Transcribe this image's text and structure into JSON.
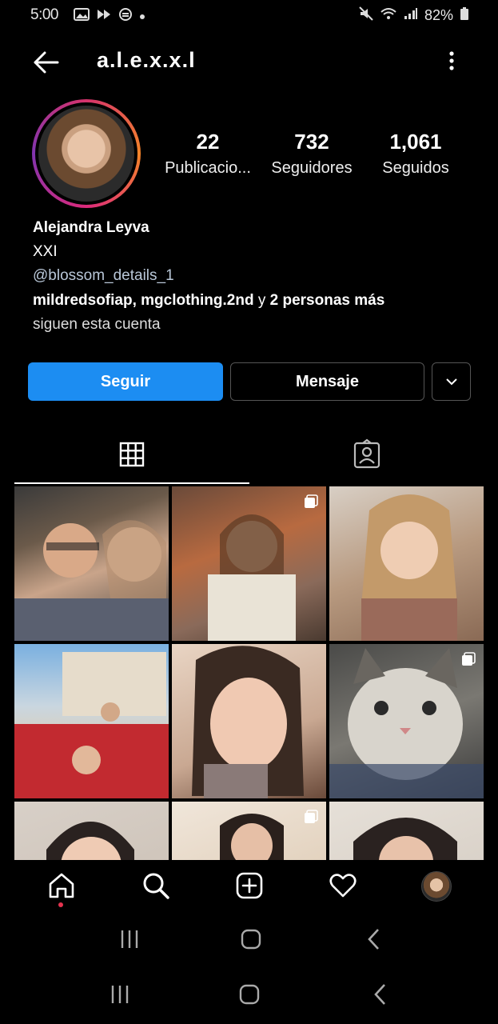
{
  "status_bar": {
    "time": "5:00",
    "battery": "82%"
  },
  "header": {
    "username": "a.l.e.x.x.l"
  },
  "stats": [
    {
      "value": "22",
      "label": "Publicacio..."
    },
    {
      "value": "732",
      "label": "Seguidores"
    },
    {
      "value": "1,061",
      "label": "Seguidos"
    }
  ],
  "bio": {
    "name": "Alejandra Leyva",
    "category": "XXI",
    "link": "@blossom_details_1",
    "followed_by_bold": "mildredsofiap, mgclothing.2nd",
    "followed_by_and": " y ",
    "followed_by_more": "2 personas más",
    "followed_by_line2": "siguen esta cuenta"
  },
  "buttons": {
    "follow": "Seguir",
    "message": "Mensaje"
  },
  "tabs": [
    "posts-grid",
    "tagged"
  ],
  "colors": {
    "accent": "#1c8df2",
    "background": "#000000",
    "notification_dot": "#e5334f"
  },
  "bottom_nav": [
    "home-icon",
    "search-icon",
    "new-post-icon",
    "activity-icon",
    "profile-avatar"
  ]
}
